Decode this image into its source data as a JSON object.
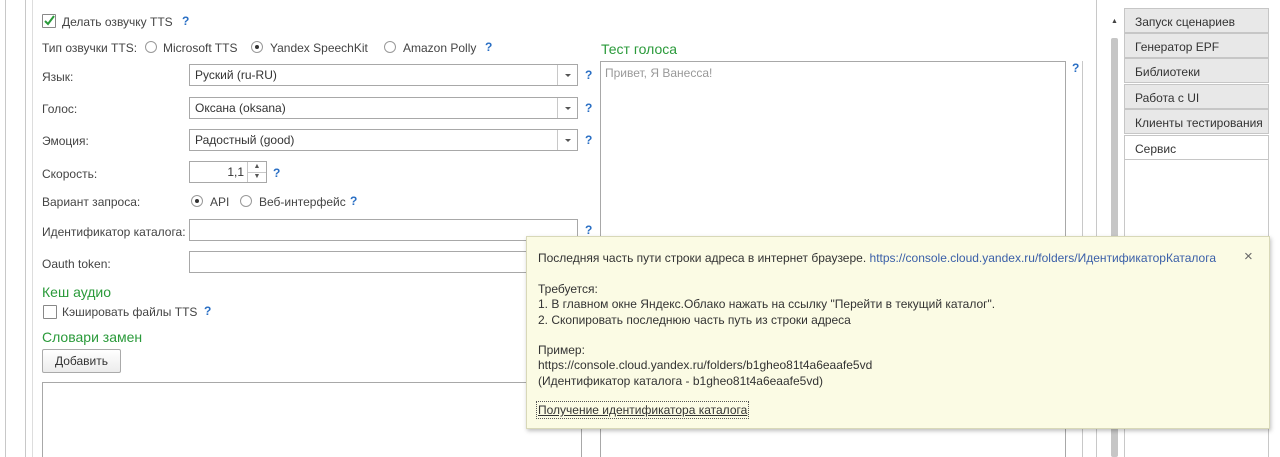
{
  "tts": {
    "enable_label": "Делать озвучку TTS",
    "type_label": "Тип озвучки TTS:",
    "types": [
      "Microsoft TTS",
      "Yandex SpeechKit",
      "Amazon Polly"
    ],
    "selected_type": "Yandex SpeechKit"
  },
  "form": {
    "language_label": "Язык:",
    "language_value": "Руский (ru-RU)",
    "voice_label": "Голос:",
    "voice_value": "Оксана (oksana)",
    "emotion_label": "Эмоция:",
    "emotion_value": "Радостный (good)",
    "speed_label": "Скорость:",
    "speed_value": "1,1",
    "request_label": "Вариант запроса:",
    "request_options": [
      "API",
      "Веб-интерфейс"
    ],
    "request_selected": "API",
    "catalog_label": "Идентификатор каталога:",
    "catalog_value": "",
    "oauth_label": "Oauth token:",
    "oauth_value": ""
  },
  "help_mark": "?",
  "voice_test": {
    "title": "Тест голоса",
    "placeholder": "Привет, Я Ванесса!"
  },
  "cache": {
    "title": "Кеш аудио",
    "cache_label": "Кэшировать файлы TTS"
  },
  "dict": {
    "title": "Словари замен",
    "add_button": "Добавить"
  },
  "tabs": [
    "Запуск сценариев",
    "Генератор EPF",
    "Библиотеки",
    "Работа с UI",
    "Клиенты тестирования",
    "Сервис"
  ],
  "active_tab": "Сервис",
  "tooltip": {
    "line1_text": "Последняя часть пути строки адреса в интернет браузере.",
    "line1_link": "https://console.cloud.yandex.ru/folders/ИдентификаторКаталога",
    "required": "Требуется:",
    "step1": "1. В главном окне Яндекс.Облако нажать на ссылку \"Перейти в текущий каталог\".",
    "step2": "2. Скопировать последнюю часть путь из строки адреса",
    "example": "Пример:",
    "example_link": "https://console.cloud.yandex.ru/folders/b1gheo81t4a6eaafe5vd",
    "example_note": "(Идентификатор каталога - b1gheo81t4a6eaafe5vd)",
    "help_link": "Получение идентификатора каталога",
    "close": "×"
  }
}
